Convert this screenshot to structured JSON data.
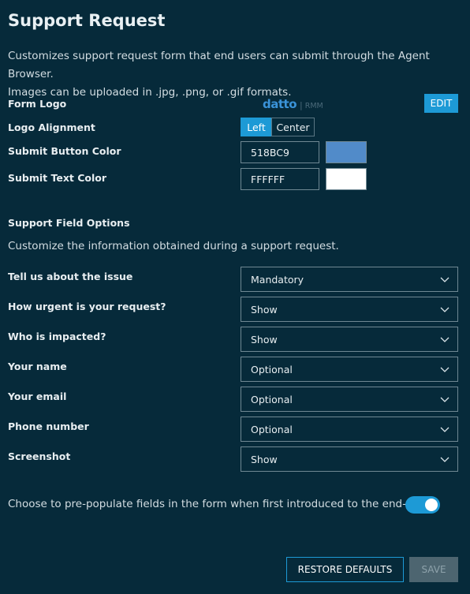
{
  "page": {
    "title": "Support Request",
    "description_line1": "Customizes support request form that end users can submit through the Agent Browser.",
    "description_line2": "Images can be uploaded in .jpg, .png, or .gif formats."
  },
  "form_logo": {
    "label": "Form Logo",
    "logo_brand": "datto",
    "logo_separator": "|",
    "logo_product": "RMM",
    "edit_label": "EDIT"
  },
  "logo_alignment": {
    "label": "Logo Alignment",
    "options": [
      "Left",
      "Center"
    ],
    "selected": "Left"
  },
  "submit_button_color": {
    "label": "Submit Button Color",
    "value": "518BC9",
    "swatch": "#518BC9"
  },
  "submit_text_color": {
    "label": "Submit Text Color",
    "value": "FFFFFF",
    "swatch": "#FFFFFF"
  },
  "support_fields": {
    "heading": "Support Field Options",
    "description": "Customize the information obtained during a support request.",
    "rows": [
      {
        "label": "Tell us about the issue",
        "value": "Mandatory"
      },
      {
        "label": "How urgent is your request?",
        "value": "Show"
      },
      {
        "label": "Who is impacted?",
        "value": "Show"
      },
      {
        "label": "Your name",
        "value": "Optional"
      },
      {
        "label": "Your email",
        "value": "Optional"
      },
      {
        "label": "Phone number",
        "value": "Optional"
      },
      {
        "label": "Screenshot",
        "value": "Show"
      }
    ]
  },
  "prepopulate": {
    "label": "Choose to pre-populate fields in the form when first introduced to the end-user.",
    "enabled": true
  },
  "actions": {
    "restore_label": "RESTORE DEFAULTS",
    "save_label": "SAVE"
  },
  "colors": {
    "background": "#062a3a",
    "accent": "#1d9ad6",
    "disabled": "#4d6570"
  },
  "icons": {
    "dropdown": "chevron-down-icon"
  }
}
